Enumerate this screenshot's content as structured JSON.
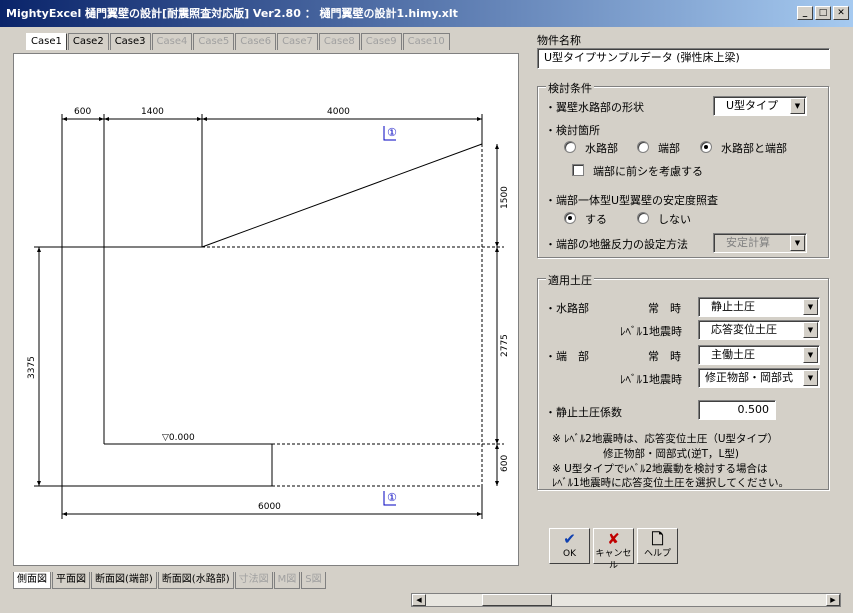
{
  "window": {
    "title": "MightyExcel 樋門翼壁の設計[耐震照査対応版] Ver2.80 ： 樋門翼壁の設計1.himy.xlt"
  },
  "case_tabs": [
    "Case1",
    "Case2",
    "Case3",
    "Case4",
    "Case5",
    "Case6",
    "Case7",
    "Case8",
    "Case9",
    "Case10"
  ],
  "view_tabs": [
    "側面図",
    "平面図",
    "断面図(端部)",
    "断面図(水路部)",
    "寸法図",
    "M図",
    "S図"
  ],
  "drawing": {
    "dims": {
      "d600a": "600",
      "d1400": "1400",
      "d4000": "4000",
      "d1500": "1500",
      "d3375": "3375",
      "d2775": "2775",
      "d600b": "600",
      "d6000": "6000"
    },
    "level_label": "▽0.000",
    "section_mark": "①"
  },
  "property": {
    "label": "物件名称",
    "value": "U型タイプサンプルデータ (弾性床上梁)"
  },
  "conditions": {
    "title": "検討条件",
    "shape_label": "・翼壁水路部の形状",
    "shape_value": "U型タイプ",
    "location_label": "・検討箇所",
    "loc_opt1": "水路部",
    "loc_opt2": "端部",
    "loc_opt3": "水路部と端部",
    "front_label": "端部に前シを考慮する",
    "stability_label": "・端部一体型U型翼壁の安定度照査",
    "stab_yes": "する",
    "stab_no": "しない",
    "reaction_label": "・端部の地盤反力の設定方法",
    "reaction_value": "安定計算"
  },
  "earth": {
    "title": "適用土圧",
    "water_label": "・水路部",
    "end_label": "・端　部",
    "normal_label": "常　時",
    "level1_label": "ﾚﾍﾞﾙ1地震時",
    "water_normal": "静止土圧",
    "water_level1": "応答変位土圧",
    "end_normal": "主働土圧",
    "end_level1": "修正物部・岡部式",
    "coef_label": "・静止土圧係数",
    "coef_value": "0.500",
    "note1": "※ ﾚﾍﾞﾙ2地震時は、応答変位土圧（U型タイプ）",
    "note2": "修正物部・岡部式(逆T，L型)",
    "note3": "※ U型タイプでﾚﾍﾞﾙ2地震動を検討する場合は",
    "note4": "ﾚﾍﾞﾙ1地震時に応答変位土圧を選択してください。"
  },
  "buttons": {
    "ok": "OK",
    "cancel": "キャンセル",
    "help": "ヘルプ"
  }
}
